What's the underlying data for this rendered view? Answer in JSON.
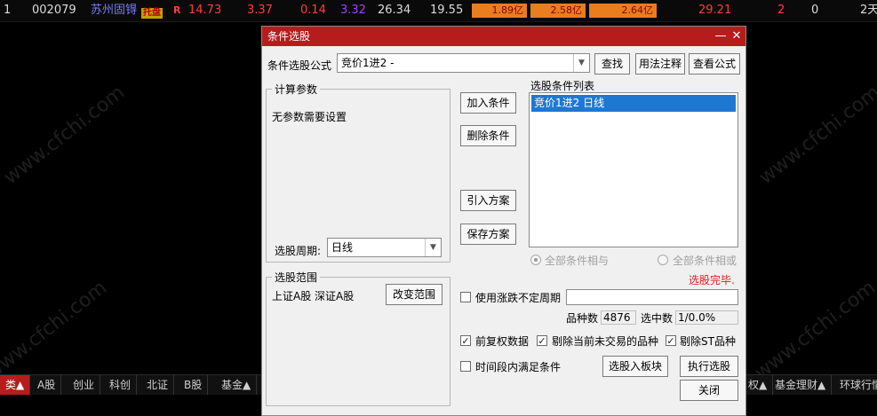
{
  "stock_row": {
    "index": "1",
    "code": "002079",
    "name": "苏州固锝",
    "badge": "托盘",
    "flag": "R",
    "price": "14.73",
    "v1": "3.37",
    "v2": "0.14",
    "v3": "3.32",
    "v4": "26.34",
    "v5": "19.55",
    "amount1": "1.89亿",
    "amount2": "2.58亿",
    "amount3": "2.64亿",
    "v6": "29.21",
    "v7": "2",
    "v8": "0",
    "v9": "2天",
    "colors": {
      "up": "#ff3c3c",
      "purple": "#a040ff",
      "name": "#7a7aff",
      "orange": "#e87e1e"
    }
  },
  "watermark": "www.cfchi.com",
  "bottom_tabs": [
    "类▲",
    "A股",
    "创业",
    "科创",
    "北证",
    "B股",
    "基金▲"
  ],
  "bottom_tabs_right": [
    "权▲",
    "基金理财▲",
    "环球行情"
  ],
  "dialog": {
    "title": "条件选股",
    "minimize": "—",
    "close": "✕",
    "formula_label": "条件选股公式",
    "formula_value": "竞价1进2      -",
    "btn_find": "查找",
    "btn_usage": "用法注释",
    "btn_view": "查看公式",
    "params_group": "计算参数",
    "params_text": "无参数需要设置",
    "period_label": "选股周期:",
    "period_value": "日线",
    "scope_group": "选股范围",
    "scope_text": "上证A股 深证A股",
    "btn_change_scope": "改变范围",
    "btn_add": "加入条件",
    "btn_delete": "删除条件",
    "btn_import": "引入方案",
    "btn_save": "保存方案",
    "list_title": "选股条件列表",
    "list_items": [
      "竞价1进2  日线"
    ],
    "radio_and": "全部条件相与",
    "radio_or": "全部条件相或",
    "status": "选股完毕.",
    "status_color": "#e02020",
    "cb_unfixed": "使用涨跌不定周期",
    "count_label": "品种数",
    "count_value": "4876",
    "selected_label": "选中数",
    "selected_value": "1/0.0%",
    "cb_adjusted": "前复权数据",
    "cb_no_trade": "剔除当前未交易的品种",
    "cb_st": "剔除ST品种",
    "cb_period": "时间段内满足条件",
    "btn_to_block": "选股入板块",
    "btn_execute": "执行选股",
    "btn_close": "关闭",
    "check_mark": "✓"
  }
}
